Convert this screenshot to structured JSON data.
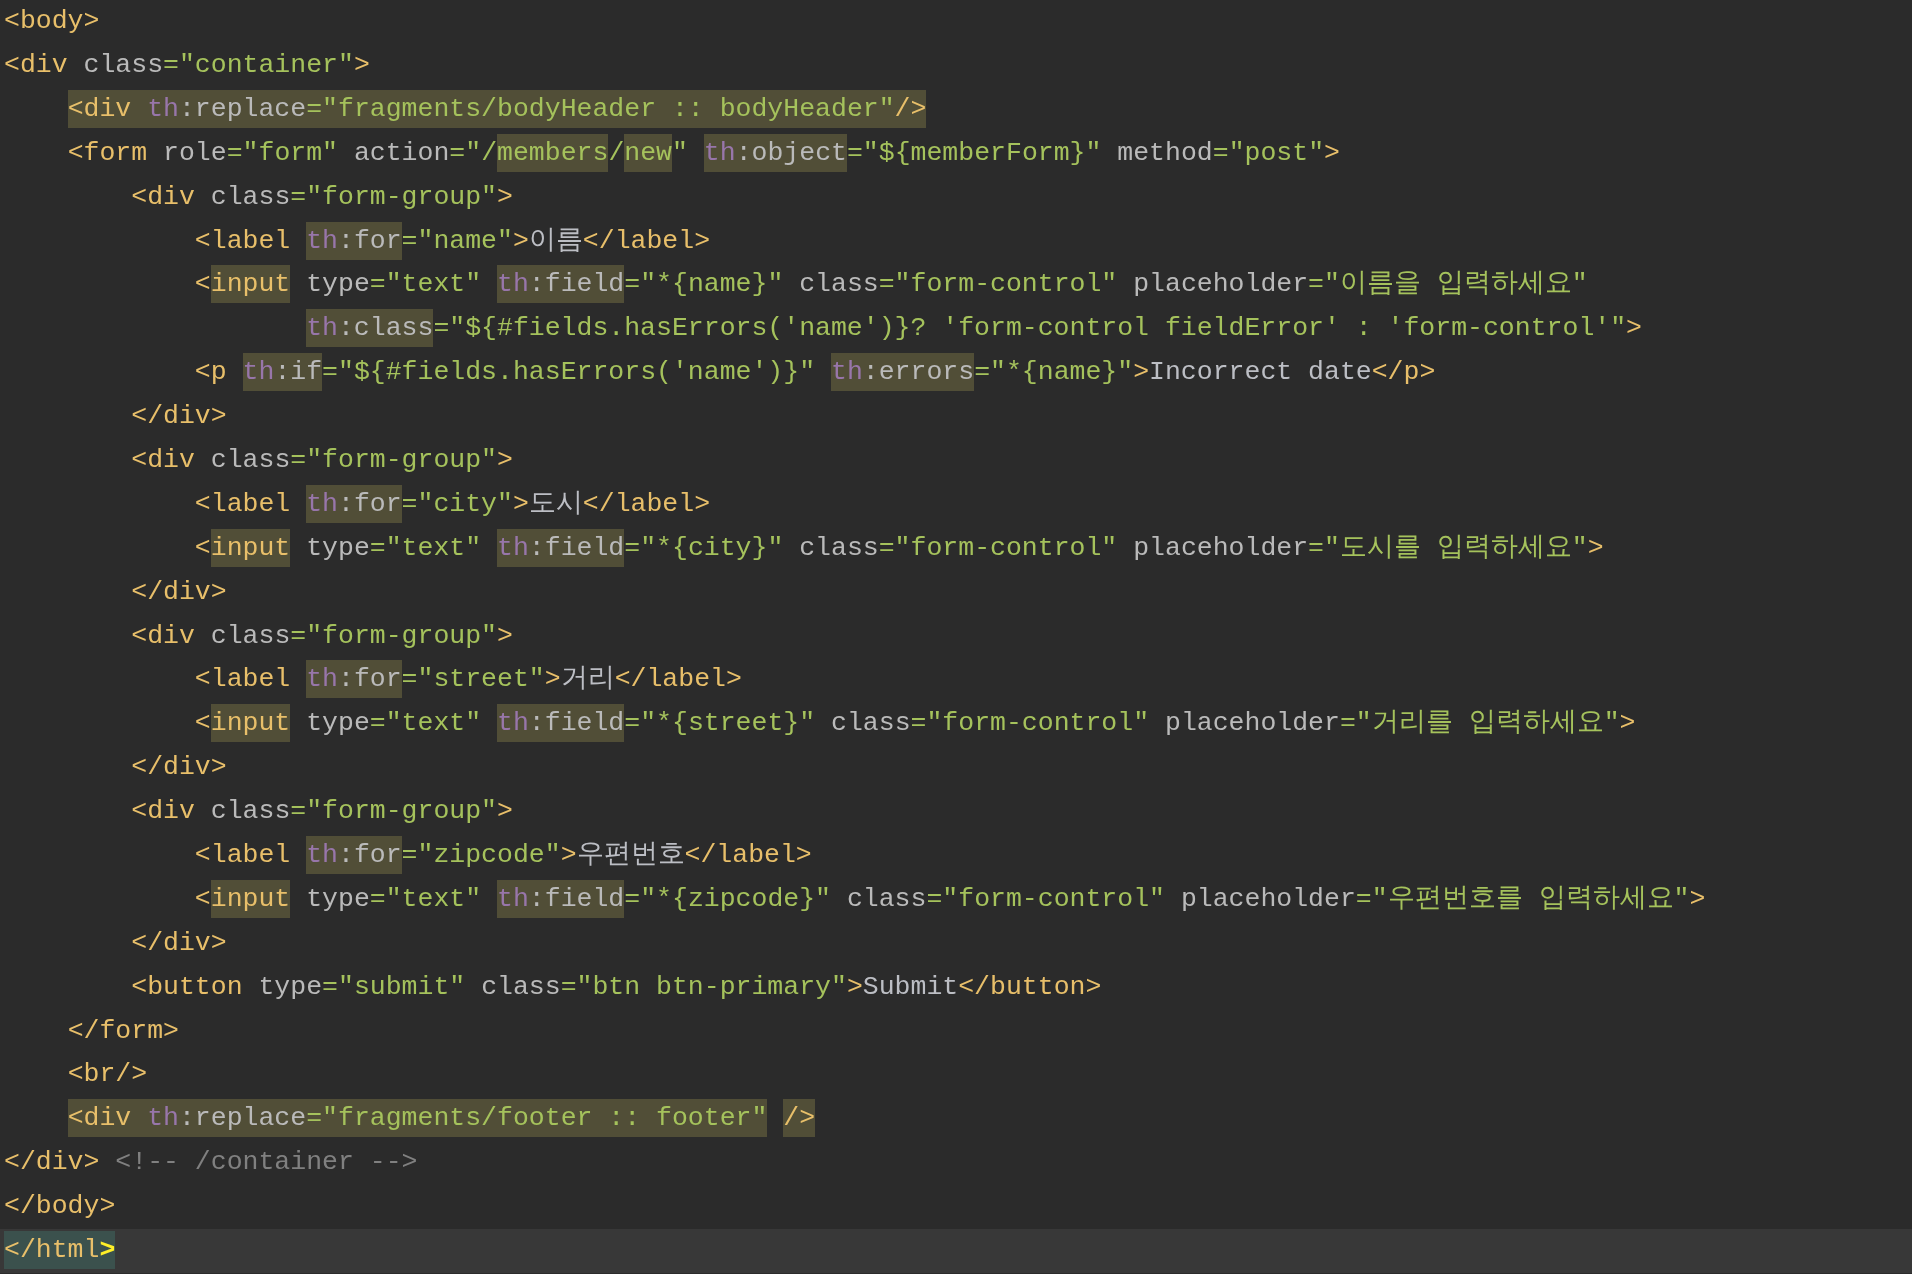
{
  "editor": {
    "lines": [
      {
        "current": false,
        "tokens": [
          {
            "text": "<body>",
            "kind": "tag",
            "highlighted": false,
            "matched": false
          }
        ]
      },
      {
        "current": false,
        "tokens": [
          {
            "text": "<div",
            "kind": "tag",
            "highlighted": false,
            "matched": false
          },
          {
            "text": " class",
            "kind": "attr",
            "highlighted": false,
            "matched": false
          },
          {
            "text": "=\"container\"",
            "kind": "string",
            "highlighted": false,
            "matched": false
          },
          {
            "text": ">",
            "kind": "tag",
            "highlighted": false,
            "matched": false
          }
        ]
      },
      {
        "current": false,
        "tokens": [
          {
            "text": "    <div ",
            "kind": "tag",
            "highlighted": true,
            "matched": false
          },
          {
            "text": "th",
            "kind": "ns",
            "highlighted": true,
            "matched": false
          },
          {
            "text": ":replace",
            "kind": "attr",
            "highlighted": true,
            "matched": false
          },
          {
            "text": "=\"fragments/bodyHeader :: bodyHeader\"",
            "kind": "string",
            "highlighted": true,
            "matched": false
          },
          {
            "text": "/>",
            "kind": "tag",
            "highlighted": true,
            "matched": false
          }
        ]
      },
      {
        "current": false,
        "tokens": [
          {
            "text": "    <form",
            "kind": "tag",
            "highlighted": false,
            "matched": false
          },
          {
            "text": " role",
            "kind": "attr",
            "highlighted": false,
            "matched": false
          },
          {
            "text": "=\"form\"",
            "kind": "string",
            "highlighted": false,
            "matched": false
          },
          {
            "text": " action",
            "kind": "attr",
            "highlighted": false,
            "matched": false
          },
          {
            "text": "=\"/",
            "kind": "string",
            "highlighted": false,
            "matched": false
          },
          {
            "text": "members",
            "kind": "string",
            "highlighted": true,
            "matched": false
          },
          {
            "text": "/",
            "kind": "string",
            "highlighted": false,
            "matched": false
          },
          {
            "text": "new",
            "kind": "string",
            "highlighted": true,
            "matched": false
          },
          {
            "text": "\" ",
            "kind": "string",
            "highlighted": false,
            "matched": false
          },
          {
            "text": "th",
            "kind": "ns",
            "highlighted": true,
            "matched": false
          },
          {
            "text": ":object",
            "kind": "attr",
            "highlighted": true,
            "matched": false
          },
          {
            "text": "=\"${memberForm}\"",
            "kind": "string",
            "highlighted": false,
            "matched": false
          },
          {
            "text": " method",
            "kind": "attr",
            "highlighted": false,
            "matched": false
          },
          {
            "text": "=\"post\"",
            "kind": "string",
            "highlighted": false,
            "matched": false
          },
          {
            "text": ">",
            "kind": "tag",
            "highlighted": false,
            "matched": false
          }
        ]
      },
      {
        "current": false,
        "tokens": [
          {
            "text": "        <div",
            "kind": "tag",
            "highlighted": false,
            "matched": false
          },
          {
            "text": " class",
            "kind": "attr",
            "highlighted": false,
            "matched": false
          },
          {
            "text": "=\"form-group\"",
            "kind": "string",
            "highlighted": false,
            "matched": false
          },
          {
            "text": ">",
            "kind": "tag",
            "highlighted": false,
            "matched": false
          }
        ]
      },
      {
        "current": false,
        "tokens": [
          {
            "text": "            <label ",
            "kind": "tag",
            "highlighted": false,
            "matched": false
          },
          {
            "text": "th",
            "kind": "ns",
            "highlighted": true,
            "matched": false
          },
          {
            "text": ":for",
            "kind": "attr",
            "highlighted": true,
            "matched": false
          },
          {
            "text": "=\"name\"",
            "kind": "string",
            "highlighted": false,
            "matched": false
          },
          {
            "text": ">",
            "kind": "tag",
            "highlighted": false,
            "matched": false
          },
          {
            "text": "이름",
            "kind": "text",
            "highlighted": false,
            "matched": false
          },
          {
            "text": "</label>",
            "kind": "tag",
            "highlighted": false,
            "matched": false
          }
        ]
      },
      {
        "current": false,
        "tokens": [
          {
            "text": "            <",
            "kind": "tag",
            "highlighted": false,
            "matched": false
          },
          {
            "text": "input",
            "kind": "tag",
            "highlighted": true,
            "matched": false
          },
          {
            "text": " type",
            "kind": "attr",
            "highlighted": false,
            "matched": false
          },
          {
            "text": "=\"text\" ",
            "kind": "string",
            "highlighted": false,
            "matched": false
          },
          {
            "text": "th",
            "kind": "ns",
            "highlighted": true,
            "matched": false
          },
          {
            "text": ":field",
            "kind": "attr",
            "highlighted": true,
            "matched": false
          },
          {
            "text": "=\"*{name}\"",
            "kind": "string",
            "highlighted": false,
            "matched": false
          },
          {
            "text": " class",
            "kind": "attr",
            "highlighted": false,
            "matched": false
          },
          {
            "text": "=\"form-control\"",
            "kind": "string",
            "highlighted": false,
            "matched": false
          },
          {
            "text": " placeholder",
            "kind": "attr",
            "highlighted": false,
            "matched": false
          },
          {
            "text": "=\"이름을 입력하세요\"",
            "kind": "string",
            "highlighted": false,
            "matched": false
          }
        ]
      },
      {
        "current": false,
        "tokens": [
          {
            "text": "                   th",
            "kind": "ns",
            "highlighted": true,
            "matched": false
          },
          {
            "text": ":class",
            "kind": "attr",
            "highlighted": true,
            "matched": false
          },
          {
            "text": "=\"${#fields.hasErrors('name')}? 'form-control fieldError' : 'form-control'\"",
            "kind": "string",
            "highlighted": false,
            "matched": false
          },
          {
            "text": ">",
            "kind": "tag",
            "highlighted": false,
            "matched": false
          }
        ]
      },
      {
        "current": false,
        "tokens": [
          {
            "text": "            <p ",
            "kind": "tag",
            "highlighted": false,
            "matched": false
          },
          {
            "text": "th",
            "kind": "ns",
            "highlighted": true,
            "matched": false
          },
          {
            "text": ":if",
            "kind": "attr",
            "highlighted": true,
            "matched": false
          },
          {
            "text": "=\"${#fields.hasErrors('name')}\" ",
            "kind": "string",
            "highlighted": false,
            "matched": false
          },
          {
            "text": "th",
            "kind": "ns",
            "highlighted": true,
            "matched": false
          },
          {
            "text": ":errors",
            "kind": "attr",
            "highlighted": true,
            "matched": false
          },
          {
            "text": "=\"*{name}\"",
            "kind": "string",
            "highlighted": false,
            "matched": false
          },
          {
            "text": ">",
            "kind": "tag",
            "highlighted": false,
            "matched": false
          },
          {
            "text": "Incorrect date",
            "kind": "text",
            "highlighted": false,
            "matched": false
          },
          {
            "text": "</p>",
            "kind": "tag",
            "highlighted": false,
            "matched": false
          }
        ]
      },
      {
        "current": false,
        "tokens": [
          {
            "text": "        </div>",
            "kind": "tag",
            "highlighted": false,
            "matched": false
          }
        ]
      },
      {
        "current": false,
        "tokens": [
          {
            "text": "        <div",
            "kind": "tag",
            "highlighted": false,
            "matched": false
          },
          {
            "text": " class",
            "kind": "attr",
            "highlighted": false,
            "matched": false
          },
          {
            "text": "=\"form-group\"",
            "kind": "string",
            "highlighted": false,
            "matched": false
          },
          {
            "text": ">",
            "kind": "tag",
            "highlighted": false,
            "matched": false
          }
        ]
      },
      {
        "current": false,
        "tokens": [
          {
            "text": "            <label ",
            "kind": "tag",
            "highlighted": false,
            "matched": false
          },
          {
            "text": "th",
            "kind": "ns",
            "highlighted": true,
            "matched": false
          },
          {
            "text": ":for",
            "kind": "attr",
            "highlighted": true,
            "matched": false
          },
          {
            "text": "=\"city\"",
            "kind": "string",
            "highlighted": false,
            "matched": false
          },
          {
            "text": ">",
            "kind": "tag",
            "highlighted": false,
            "matched": false
          },
          {
            "text": "도시",
            "kind": "text",
            "highlighted": false,
            "matched": false
          },
          {
            "text": "</label>",
            "kind": "tag",
            "highlighted": false,
            "matched": false
          }
        ]
      },
      {
        "current": false,
        "tokens": [
          {
            "text": "            <",
            "kind": "tag",
            "highlighted": false,
            "matched": false
          },
          {
            "text": "input",
            "kind": "tag",
            "highlighted": true,
            "matched": false
          },
          {
            "text": " type",
            "kind": "attr",
            "highlighted": false,
            "matched": false
          },
          {
            "text": "=\"text\" ",
            "kind": "string",
            "highlighted": false,
            "matched": false
          },
          {
            "text": "th",
            "kind": "ns",
            "highlighted": true,
            "matched": false
          },
          {
            "text": ":field",
            "kind": "attr",
            "highlighted": true,
            "matched": false
          },
          {
            "text": "=\"*{city}\"",
            "kind": "string",
            "highlighted": false,
            "matched": false
          },
          {
            "text": " class",
            "kind": "attr",
            "highlighted": false,
            "matched": false
          },
          {
            "text": "=\"form-control\"",
            "kind": "string",
            "highlighted": false,
            "matched": false
          },
          {
            "text": " placeholder",
            "kind": "attr",
            "highlighted": false,
            "matched": false
          },
          {
            "text": "=\"도시를 입력하세요\"",
            "kind": "string",
            "highlighted": false,
            "matched": false
          },
          {
            "text": ">",
            "kind": "tag",
            "highlighted": false,
            "matched": false
          }
        ]
      },
      {
        "current": false,
        "tokens": [
          {
            "text": "        </div>",
            "kind": "tag",
            "highlighted": false,
            "matched": false
          }
        ]
      },
      {
        "current": false,
        "tokens": [
          {
            "text": "        <div",
            "kind": "tag",
            "highlighted": false,
            "matched": false
          },
          {
            "text": " class",
            "kind": "attr",
            "highlighted": false,
            "matched": false
          },
          {
            "text": "=\"form-group\"",
            "kind": "string",
            "highlighted": false,
            "matched": false
          },
          {
            "text": ">",
            "kind": "tag",
            "highlighted": false,
            "matched": false
          }
        ]
      },
      {
        "current": false,
        "tokens": [
          {
            "text": "            <label ",
            "kind": "tag",
            "highlighted": false,
            "matched": false
          },
          {
            "text": "th",
            "kind": "ns",
            "highlighted": true,
            "matched": false
          },
          {
            "text": ":for",
            "kind": "attr",
            "highlighted": true,
            "matched": false
          },
          {
            "text": "=\"street\"",
            "kind": "string",
            "highlighted": false,
            "matched": false
          },
          {
            "text": ">",
            "kind": "tag",
            "highlighted": false,
            "matched": false
          },
          {
            "text": "거리",
            "kind": "text",
            "highlighted": false,
            "matched": false
          },
          {
            "text": "</label>",
            "kind": "tag",
            "highlighted": false,
            "matched": false
          }
        ]
      },
      {
        "current": false,
        "tokens": [
          {
            "text": "            <",
            "kind": "tag",
            "highlighted": false,
            "matched": false
          },
          {
            "text": "input",
            "kind": "tag",
            "highlighted": true,
            "matched": false
          },
          {
            "text": " type",
            "kind": "attr",
            "highlighted": false,
            "matched": false
          },
          {
            "text": "=\"text\" ",
            "kind": "string",
            "highlighted": false,
            "matched": false
          },
          {
            "text": "th",
            "kind": "ns",
            "highlighted": true,
            "matched": false
          },
          {
            "text": ":field",
            "kind": "attr",
            "highlighted": true,
            "matched": false
          },
          {
            "text": "=\"*{street}\"",
            "kind": "string",
            "highlighted": false,
            "matched": false
          },
          {
            "text": " class",
            "kind": "attr",
            "highlighted": false,
            "matched": false
          },
          {
            "text": "=\"form-control\"",
            "kind": "string",
            "highlighted": false,
            "matched": false
          },
          {
            "text": " placeholder",
            "kind": "attr",
            "highlighted": false,
            "matched": false
          },
          {
            "text": "=\"거리를 입력하세요\"",
            "kind": "string",
            "highlighted": false,
            "matched": false
          },
          {
            "text": ">",
            "kind": "tag",
            "highlighted": false,
            "matched": false
          }
        ]
      },
      {
        "current": false,
        "tokens": [
          {
            "text": "        </div>",
            "kind": "tag",
            "highlighted": false,
            "matched": false
          }
        ]
      },
      {
        "current": false,
        "tokens": [
          {
            "text": "        <div",
            "kind": "tag",
            "highlighted": false,
            "matched": false
          },
          {
            "text": " class",
            "kind": "attr",
            "highlighted": false,
            "matched": false
          },
          {
            "text": "=\"form-group\"",
            "kind": "string",
            "highlighted": false,
            "matched": false
          },
          {
            "text": ">",
            "kind": "tag",
            "highlighted": false,
            "matched": false
          }
        ]
      },
      {
        "current": false,
        "tokens": [
          {
            "text": "            <label ",
            "kind": "tag",
            "highlighted": false,
            "matched": false
          },
          {
            "text": "th",
            "kind": "ns",
            "highlighted": true,
            "matched": false
          },
          {
            "text": ":for",
            "kind": "attr",
            "highlighted": true,
            "matched": false
          },
          {
            "text": "=\"zipcode\"",
            "kind": "string",
            "highlighted": false,
            "matched": false
          },
          {
            "text": ">",
            "kind": "tag",
            "highlighted": false,
            "matched": false
          },
          {
            "text": "우편번호",
            "kind": "text",
            "highlighted": false,
            "matched": false
          },
          {
            "text": "</label>",
            "kind": "tag",
            "highlighted": false,
            "matched": false
          }
        ]
      },
      {
        "current": false,
        "tokens": [
          {
            "text": "            <",
            "kind": "tag",
            "highlighted": false,
            "matched": false
          },
          {
            "text": "input",
            "kind": "tag",
            "highlighted": true,
            "matched": false
          },
          {
            "text": " type",
            "kind": "attr",
            "highlighted": false,
            "matched": false
          },
          {
            "text": "=\"text\" ",
            "kind": "string",
            "highlighted": false,
            "matched": false
          },
          {
            "text": "th",
            "kind": "ns",
            "highlighted": true,
            "matched": false
          },
          {
            "text": ":field",
            "kind": "attr",
            "highlighted": true,
            "matched": false
          },
          {
            "text": "=\"*{zipcode}\"",
            "kind": "string",
            "highlighted": false,
            "matched": false
          },
          {
            "text": " class",
            "kind": "attr",
            "highlighted": false,
            "matched": false
          },
          {
            "text": "=\"form-control\"",
            "kind": "string",
            "highlighted": false,
            "matched": false
          },
          {
            "text": " placeholder",
            "kind": "attr",
            "highlighted": false,
            "matched": false
          },
          {
            "text": "=\"우편번호를 입력하세요\"",
            "kind": "string",
            "highlighted": false,
            "matched": false
          },
          {
            "text": ">",
            "kind": "tag",
            "highlighted": false,
            "matched": false
          }
        ]
      },
      {
        "current": false,
        "tokens": [
          {
            "text": "        </div>",
            "kind": "tag",
            "highlighted": false,
            "matched": false
          }
        ]
      },
      {
        "current": false,
        "tokens": [
          {
            "text": "        <button",
            "kind": "tag",
            "highlighted": false,
            "matched": false
          },
          {
            "text": " type",
            "kind": "attr",
            "highlighted": false,
            "matched": false
          },
          {
            "text": "=\"submit\"",
            "kind": "string",
            "highlighted": false,
            "matched": false
          },
          {
            "text": " class",
            "kind": "attr",
            "highlighted": false,
            "matched": false
          },
          {
            "text": "=\"btn btn-primary\"",
            "kind": "string",
            "highlighted": false,
            "matched": false
          },
          {
            "text": ">",
            "kind": "tag",
            "highlighted": false,
            "matched": false
          },
          {
            "text": "Submit",
            "kind": "text",
            "highlighted": false,
            "matched": false
          },
          {
            "text": "</button>",
            "kind": "tag",
            "highlighted": false,
            "matched": false
          }
        ]
      },
      {
        "current": false,
        "tokens": [
          {
            "text": "    </form>",
            "kind": "tag",
            "highlighted": false,
            "matched": false
          }
        ]
      },
      {
        "current": false,
        "tokens": [
          {
            "text": "    <br/>",
            "kind": "tag",
            "highlighted": false,
            "matched": false
          }
        ]
      },
      {
        "current": false,
        "tokens": [
          {
            "text": "    <div ",
            "kind": "tag",
            "highlighted": true,
            "matched": false
          },
          {
            "text": "th",
            "kind": "ns",
            "highlighted": true,
            "matched": false
          },
          {
            "text": ":replace",
            "kind": "attr",
            "highlighted": true,
            "matched": false
          },
          {
            "text": "=\"fragments/footer :: footer\"",
            "kind": "string",
            "highlighted": true,
            "matched": false
          },
          {
            "text": " />",
            "kind": "tag",
            "highlighted": true,
            "matched": false
          }
        ]
      },
      {
        "current": false,
        "tokens": [
          {
            "text": "</div>",
            "kind": "tag",
            "highlighted": false,
            "matched": false
          },
          {
            "text": " <!-- /container -->",
            "kind": "comment",
            "highlighted": false,
            "matched": false
          }
        ]
      },
      {
        "current": false,
        "tokens": [
          {
            "text": "</body>",
            "kind": "tag",
            "highlighted": false,
            "matched": false
          }
        ]
      },
      {
        "current": true,
        "tokens": [
          {
            "text": "</html",
            "kind": "tag",
            "highlighted": false,
            "matched": true
          },
          {
            "text": ">",
            "kind": "brace",
            "highlighted": false,
            "matched": true
          }
        ]
      }
    ]
  }
}
